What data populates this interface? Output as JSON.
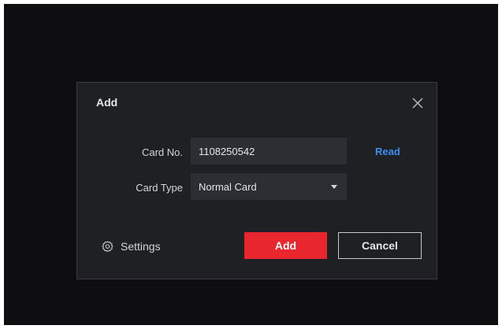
{
  "dialog": {
    "title": "Add",
    "fields": {
      "card_no_label": "Card No.",
      "card_no_value": "1108250542",
      "read_label": "Read",
      "card_type_label": "Card Type",
      "card_type_value": "Normal Card"
    },
    "footer": {
      "settings_label": "Settings",
      "add_label": "Add",
      "cancel_label": "Cancel"
    }
  },
  "icons": {
    "close": "close-icon",
    "settings": "gear-icon",
    "dropdown": "caret-down-icon"
  },
  "colors": {
    "backdrop": "#0e0e10",
    "dialog_bg": "#1f2024",
    "input_bg": "#2d2e33",
    "accent_link": "#3b8ff0",
    "primary_button": "#e8262d"
  }
}
